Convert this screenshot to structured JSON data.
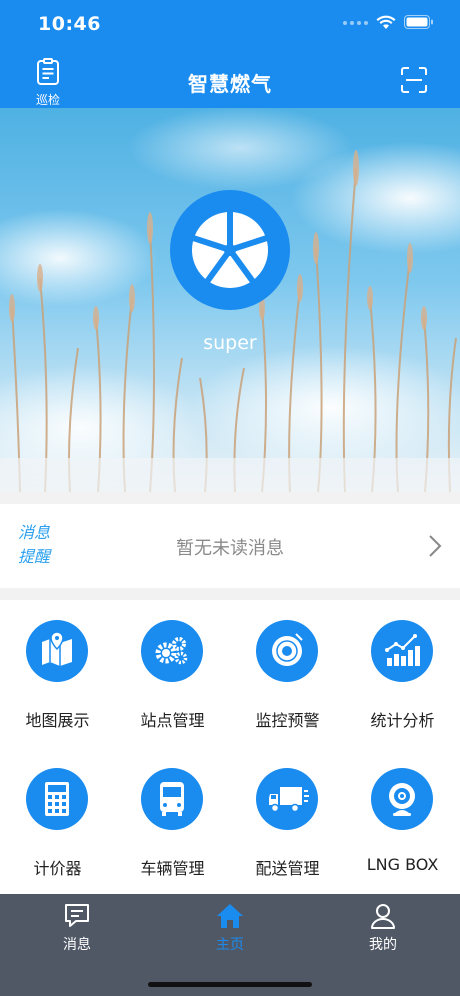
{
  "status_bar": {
    "time": "10:46",
    "icons": [
      "signal-icon",
      "wifi-icon",
      "battery-icon"
    ]
  },
  "nav": {
    "title": "智慧燃气",
    "left_label": "巡检",
    "left_icon": "clipboard-icon",
    "right_icon": "scan-icon"
  },
  "profile": {
    "username": "super",
    "avatar_icon": "wheel-icon"
  },
  "message": {
    "tag_line1": "消息",
    "tag_line2": "提醒",
    "text": "暂无未读消息"
  },
  "modules": [
    {
      "label": "地图展示",
      "icon": "map-icon"
    },
    {
      "label": "站点管理",
      "icon": "gears-icon"
    },
    {
      "label": "监控预警",
      "icon": "alarm-icon"
    },
    {
      "label": "统计分析",
      "icon": "chart-icon"
    },
    {
      "label": "计价器",
      "icon": "calculator-icon"
    },
    {
      "label": "车辆管理",
      "icon": "bus-icon"
    },
    {
      "label": "配送管理",
      "icon": "truck-icon"
    },
    {
      "label": "LNG BOX",
      "icon": "webcam-icon"
    }
  ],
  "tabs": [
    {
      "label": "消息",
      "icon": "message-icon",
      "active": false
    },
    {
      "label": "主页",
      "icon": "home-icon",
      "active": true
    },
    {
      "label": "我的",
      "icon": "user-icon",
      "active": false
    }
  ],
  "colors": {
    "primary": "#1a8cf0",
    "tab_bar": "#505866",
    "message_tag": "#2aa0f0"
  }
}
